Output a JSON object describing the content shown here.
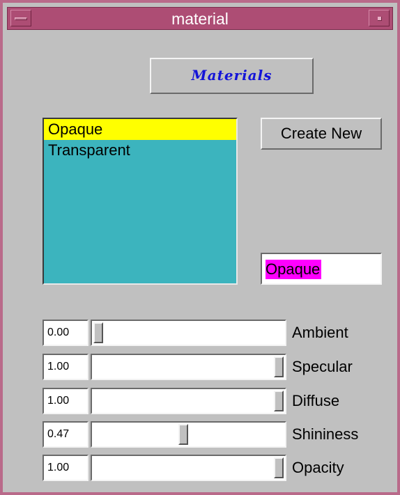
{
  "window": {
    "title": "material"
  },
  "header_button": {
    "label": "Materials"
  },
  "material_list": {
    "items": [
      "Opaque",
      "Transparent"
    ],
    "selected": "Opaque"
  },
  "create_button": {
    "label": "Create New"
  },
  "name_field": {
    "value": "Opaque"
  },
  "sliders": [
    {
      "label": "Ambient",
      "value_text": "0.00",
      "value": 0.0
    },
    {
      "label": "Specular",
      "value_text": "1.00",
      "value": 1.0
    },
    {
      "label": "Diffuse",
      "value_text": "1.00",
      "value": 1.0
    },
    {
      "label": "Shininess",
      "value_text": "0.47",
      "value": 0.47
    },
    {
      "label": "Opacity",
      "value_text": "1.00",
      "value": 1.0
    }
  ],
  "colors": {
    "title_bar": "#ad4d74",
    "list_background": "#3cb4be",
    "list_selection": "#ffff00",
    "name_highlight": "#ff00ff",
    "materials_text": "#1414d8",
    "panel": "#c0c0c0"
  },
  "icons": {
    "window_menu": "window-menu-icon",
    "minimize": "minimize-icon"
  }
}
